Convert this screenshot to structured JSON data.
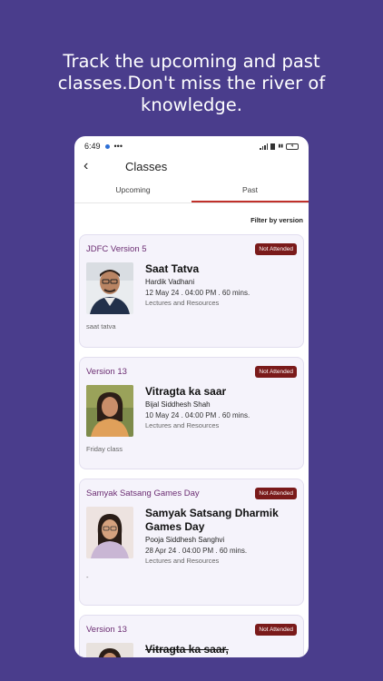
{
  "headline": "Track the upcoming and past classes.Don't miss the river of knowledge.",
  "status": {
    "time": "6:49",
    "dots": "•••",
    "battery": "4"
  },
  "appbar": {
    "title": "Classes"
  },
  "tabs": [
    {
      "label": "Upcoming",
      "active": false
    },
    {
      "label": "Past",
      "active": true
    }
  ],
  "filter_label": "Filter by version",
  "classes": [
    {
      "version": "JDFC Version 5",
      "status": "Not Attended",
      "title": "Saat Tatva",
      "teacher": "Hardik Vadhani",
      "when": "12 May 24 . 04:00 PM . 60 mins.",
      "resources": "Lectures and Resources",
      "note": "saat tatva"
    },
    {
      "version": "Version 13",
      "status": "Not Attended",
      "title": "Vitragta ka saar",
      "teacher": "Bijal Siddhesh Shah",
      "when": "10 May 24 . 04:00 PM . 60 mins.",
      "resources": "Lectures and Resources",
      "note": "Friday class"
    },
    {
      "version": "Samyak Satsang Games Day",
      "status": "Not Attended",
      "title": "Samyak Satsang Dharmik Games Day",
      "teacher": "Pooja Siddhesh Sanghvi",
      "when": "28 Apr 24 . 04:00 PM . 60 mins.",
      "resources": "Lectures and Resources",
      "note": "-"
    },
    {
      "version": "Version 13",
      "status": "Not Attended",
      "title": "Vitragta ka saar,"
    }
  ],
  "colors": {
    "background": "#4a3d8c",
    "badge": "#7a1a1a",
    "version_text": "#6b2d72",
    "tab_indicator": "#c0302a",
    "card_bg": "#f5f3fb"
  }
}
